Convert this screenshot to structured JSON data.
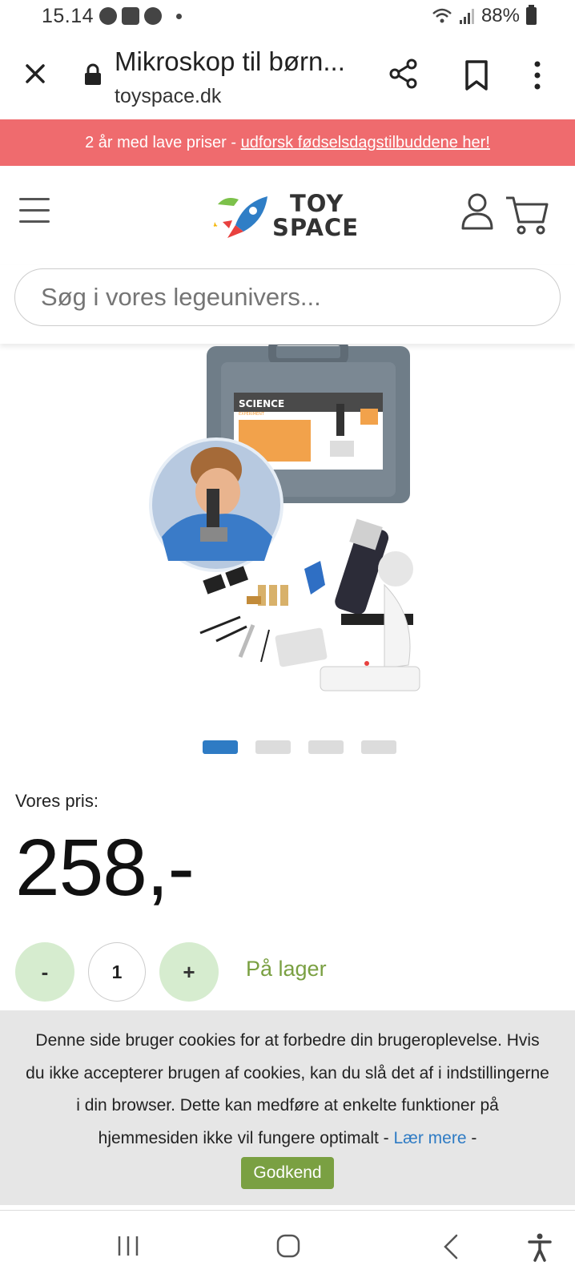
{
  "status_bar": {
    "time": "15.14",
    "battery": "88%",
    "icons": [
      "chrome-icon",
      "gallery-icon",
      "smiley-icon",
      "dot-icon",
      "wifi-icon",
      "signal-icon",
      "battery-icon"
    ]
  },
  "browser": {
    "page_title": "Mikroskop til børn...",
    "host": "toyspace.dk",
    "icons": [
      "close-icon",
      "lock-icon",
      "share-icon",
      "bookmark-icon",
      "more-vert-icon"
    ]
  },
  "promo": {
    "text": "2 år med lave priser - ",
    "link": "udforsk fødselsdagstilbuddene her!",
    "color": "#ef6b6e"
  },
  "header": {
    "logo_line1": "TOY",
    "logo_line2": "SPACE",
    "icons": [
      "menu-icon",
      "user-icon",
      "cart-icon"
    ]
  },
  "search": {
    "placeholder": "Søg i vores legeunivers..."
  },
  "product": {
    "image": "microscope-kit-image",
    "box_label": "SCIENCE",
    "box_sublabel": "EXPERIMENT",
    "carousel_count": 4,
    "carousel_active": 1,
    "price_label": "Vores pris:",
    "price": "258,-",
    "quantity": "1",
    "qty_minus": "-",
    "qty_plus": "+",
    "stock": "På lager",
    "accent_color": "#2e7bc4",
    "stock_color": "#7aa042"
  },
  "cookie": {
    "text": "Denne side bruger cookies for at forbedre din brugeroplevelse. Hvis du ikke accepterer brugen af cookies, kan du slå det af i indstillingerne i din browser. Dette kan medføre at enkelte funktioner på hjemmesiden ikke vil fungere optimalt - ",
    "learn_more": "Lær mere",
    "trailing": " -",
    "accept": "Godkend"
  },
  "nav": {
    "icons": [
      "recent-apps-icon",
      "home-icon",
      "back-icon",
      "accessibility-icon"
    ]
  }
}
